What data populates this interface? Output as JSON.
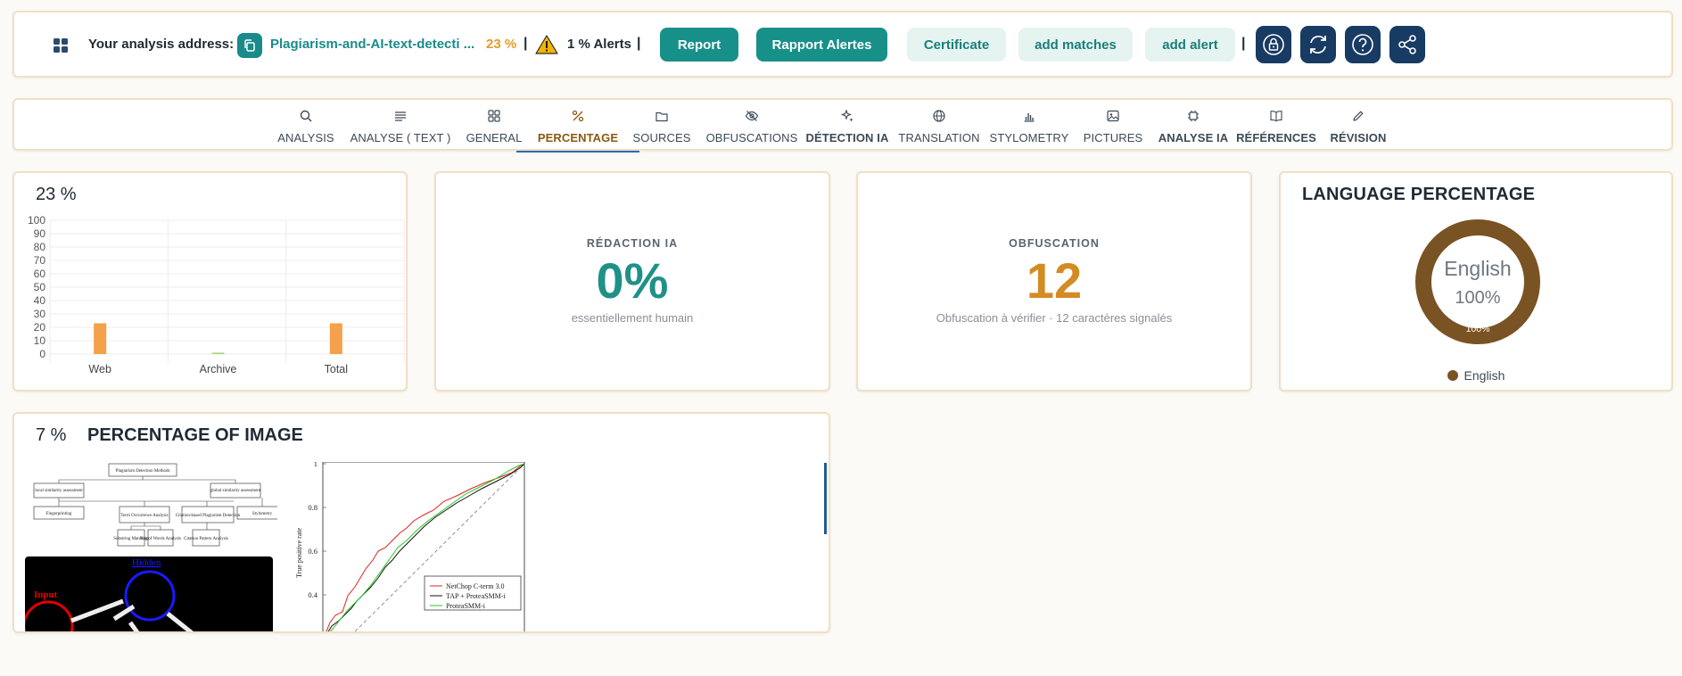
{
  "topbar": {
    "address_label": "Your analysis address:",
    "address_link": "Plagiarism-and-AI-text-detecti ...",
    "percentage": "23 %",
    "separator": "|",
    "alerts": "1 % Alerts",
    "buttons": {
      "report": "Report",
      "rapport_alertes": "Rapport Alertes",
      "certificate": "Certificate",
      "add_matches": "add matches",
      "add_alert": "add alert"
    },
    "colors": {
      "primary": "#18908a",
      "navy": "#173b63",
      "light": "#e6f4f1",
      "accent": "#e59b2e"
    }
  },
  "tabs": [
    {
      "label": "ANALYSIS",
      "icon": "search-icon"
    },
    {
      "label": "ANALYSE ( TEXT )",
      "icon": "lines-icon"
    },
    {
      "label": "GENERAL",
      "icon": "grid-icon"
    },
    {
      "label": "PERCENTAGE",
      "icon": "percent-icon",
      "active": true
    },
    {
      "label": "SOURCES",
      "icon": "folder-icon"
    },
    {
      "label": "OBFUSCATIONS",
      "icon": "eye-off-icon"
    },
    {
      "label": "DÉTECTION IA",
      "icon": "sparkles-icon"
    },
    {
      "label": "TRANSLATION",
      "icon": "globe-icon"
    },
    {
      "label": "STYLOMETRY",
      "icon": "bar-chart-icon"
    },
    {
      "label": "PICTURES",
      "icon": "image-icon"
    },
    {
      "label": "ANALYSE IA",
      "icon": "chip-icon"
    },
    {
      "label": "RÉFÉRENCES",
      "icon": "book-icon"
    },
    {
      "label": "RÉVISION",
      "icon": "pencil-icon"
    }
  ],
  "similarity": {
    "percentage": "23 %",
    "chart_data": {
      "type": "bar",
      "categories": [
        "Web",
        "Archive",
        "Total"
      ],
      "values": [
        23,
        1,
        23
      ],
      "colors": [
        "#f5a04a",
        "#9cd37a",
        "#f5a04a"
      ],
      "ylim": [
        0,
        100
      ],
      "yticks": [
        0,
        10,
        20,
        30,
        40,
        50,
        60,
        70,
        80,
        90,
        100
      ],
      "grid": true
    }
  },
  "redaction": {
    "title": "RÉDACTION IA",
    "value": "0%",
    "subtitle": "essentiellement humain",
    "color": "#1f9187"
  },
  "obfuscation": {
    "title": "OBFUSCATION",
    "value": "12",
    "subtitle": "Obfuscation à vérifier · 12 caractères signalés",
    "color": "#d38b23"
  },
  "language": {
    "title": "LANGUAGE PERCENTAGE",
    "center_label": "English",
    "center_value": "100%",
    "ring_label": "100%",
    "legend": "English",
    "chart_data": {
      "type": "pie",
      "categories": [
        "English"
      ],
      "values": [
        100
      ],
      "colors": [
        "#7a5324"
      ]
    }
  },
  "image_section": {
    "percentage": "7 %",
    "title": "PERCENTAGE OF IMAGE",
    "diagram": {
      "root": "Plagiarism Detection Methods",
      "local": "local similarity assessment",
      "global": "global similarity assessment",
      "fingerprinting": "Fingerprinting",
      "term": "Term Occurrence Analysis",
      "citation": "Citation-based Plagiarism Detection",
      "stylometry": "Stylometry",
      "substring": "Substring Matching",
      "bag": "Bag of Words Analysis",
      "citation_pattern": "Citation Pattern Analysis"
    },
    "network": {
      "hidden": "Hidden",
      "input": "Input"
    },
    "roc": {
      "ylabel": "True positive rate",
      "yticks": [
        "1",
        "0.8",
        "0.6",
        "0.4"
      ],
      "legend": [
        "NetChop C-term 3.0",
        "TAP + ProteaSMM-i",
        "ProteaSMM-i"
      ]
    }
  }
}
